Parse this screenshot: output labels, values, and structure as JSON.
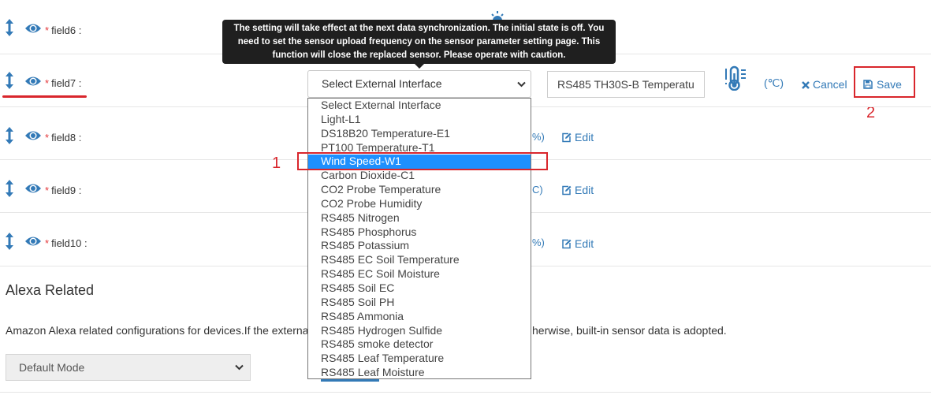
{
  "fields": [
    {
      "name": "field6",
      "required_mark": "*",
      "colon": ":"
    },
    {
      "name": "field7",
      "required_mark": "*",
      "colon": ":"
    },
    {
      "name": "field8",
      "required_mark": "*",
      "colon": ":",
      "unit_fragment": "%)",
      "edit_label": "Edit"
    },
    {
      "name": "field9",
      "required_mark": "*",
      "colon": ":",
      "unit_fragment": "C)",
      "edit_label": "Edit"
    },
    {
      "name": "field10",
      "required_mark": "*",
      "colon": ":",
      "unit_fragment": "%)",
      "edit_label": "Edit"
    }
  ],
  "tooltip": {
    "text": "The setting will take effect at the next data synchronization. The initial state is off. You need to set the sensor upload frequency on the sensor parameter setting page. This function will close the replaced sensor. Please operate with caution."
  },
  "editing_row": {
    "select_value": "Select External Interface",
    "options": [
      "Select External Interface",
      "Light-L1",
      "DS18B20 Temperature-E1",
      "PT100 Temperature-T1",
      "Wind Speed-W1",
      "Carbon Dioxide-C1",
      "CO2 Probe Temperature",
      "CO2 Probe Humidity",
      "RS485 Nitrogen",
      "RS485 Phosphorus",
      "RS485 Potassium",
      "RS485 EC Soil Temperature",
      "RS485 EC Soil Moisture",
      "RS485 Soil EC",
      "RS485 Soil PH",
      "RS485 Ammonia",
      "RS485 Hydrogen Sulfide",
      "RS485 smoke detector",
      "RS485 Leaf Temperature",
      "RS485 Leaf Moisture"
    ],
    "highlighted_option": "Wind Speed-W1",
    "sensor_name_value": "RS485 TH30S-B Temperatu",
    "unit": "(℃)",
    "cancel_label": "Cancel",
    "save_label": "Save"
  },
  "annotations": {
    "step1": "1",
    "step2": "2"
  },
  "alexa": {
    "title": "Alexa Related",
    "description_left": "Amazon Alexa related configurations for devices.If the externa",
    "description_right": "herwise, built-in sensor data is adopted.",
    "mode_value": "Default Mode"
  },
  "colors": {
    "link": "#337ab7",
    "required": "#e4393c",
    "annotation_red": "#d9262c",
    "highlight": "#1e90ff"
  }
}
